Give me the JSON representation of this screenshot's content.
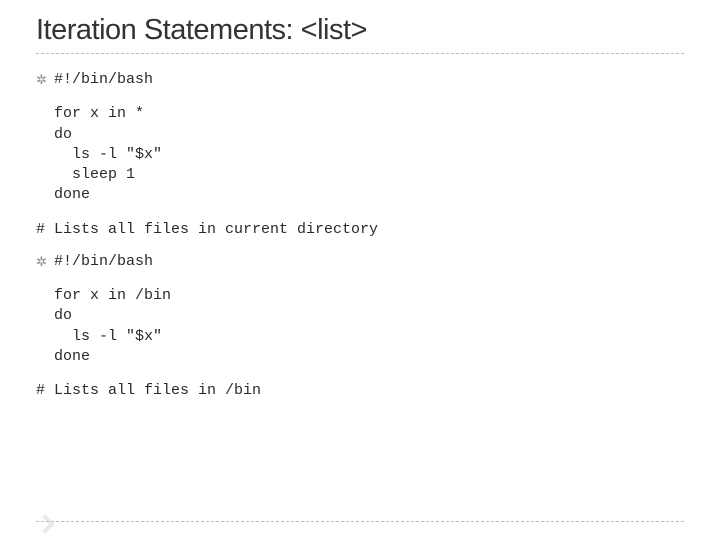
{
  "title": "Iteration Statements: <list>",
  "items": [
    {
      "bullet": "✲",
      "bulletClass": "",
      "text": "#!/bin/bash"
    },
    {
      "code": "for x in *\ndo\n  ls -l \"$x\"\n  sleep 1\ndone"
    },
    {
      "bullet": "#",
      "bulletClass": "hash",
      "text": "Lists all files in current directory"
    },
    {
      "bullet": "✲",
      "bulletClass": "",
      "text": "#!/bin/bash"
    },
    {
      "code": "for x in /bin\ndo\n  ls -l \"$x\"\ndone"
    },
    {
      "bullet": "#",
      "bulletClass": "hash",
      "text": "Lists all files in /bin"
    }
  ]
}
